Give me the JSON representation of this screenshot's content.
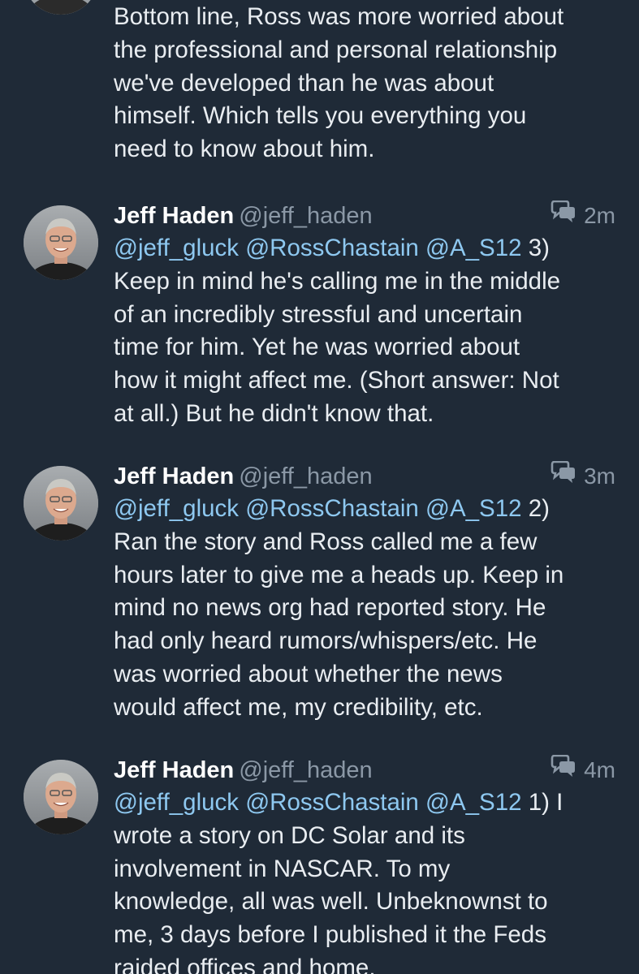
{
  "top_tweet": {
    "avatar_icon": "avatar-photo",
    "text": "Bottom line, Ross was more worried about\nthe professional and personal relationship\nwe've developed than he was about\nhimself. Which tells you everything you\nneed to know about him."
  },
  "tweets": [
    {
      "name": "Jeff Haden",
      "handle": "@jeff_haden",
      "time": "2m",
      "icon": "conversation-icon",
      "mentions": "@jeff_gluck @RossChastain @A_S12",
      "text_first": " 3)",
      "text_rest": "Keep in mind he's calling me in the middle\nof an incredibly stressful and uncertain\ntime for him. Yet he was worried about\nhow it might affect me. (Short answer: Not\nat all.) But he didn't know that."
    },
    {
      "name": "Jeff Haden",
      "handle": "@jeff_haden",
      "time": "3m",
      "icon": "conversation-icon",
      "mentions": "@jeff_gluck @RossChastain @A_S12",
      "text_first": " 2)",
      "text_rest": "Ran the story and Ross called me a few\nhours later to give me a heads up. Keep in\nmind no news org had reported story. He\nhad only heard rumors/whispers/etc. He\nwas worried about whether the news\nwould affect me, my credibility, etc."
    },
    {
      "name": "Jeff Haden",
      "handle": "@jeff_haden",
      "time": "4m",
      "icon": "conversation-icon",
      "mentions": "@jeff_gluck @RossChastain @A_S12",
      "text_first": " 1) I",
      "text_rest": "wrote a story on DC Solar and its\ninvolvement in NASCAR. To my\nknowledge, all was well. Unbeknownst to\nme, 3 days before I published it the Feds\nraided offices and home."
    }
  ],
  "colors": {
    "background": "#1f2a37",
    "text": "#e9edf1",
    "muted": "#8b98a6",
    "mention": "#8ec8f0"
  }
}
